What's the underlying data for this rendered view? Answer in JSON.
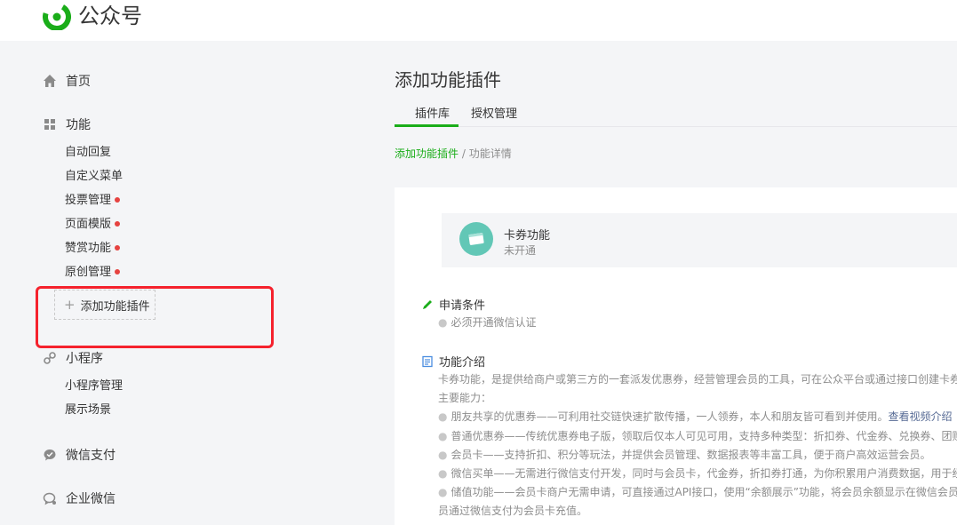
{
  "header": {
    "app_name": "公众号"
  },
  "sidebar": {
    "home": "首页",
    "features": {
      "label": "功能",
      "items": [
        {
          "label": "自动回复",
          "dot": false
        },
        {
          "label": "自定义菜单",
          "dot": false
        },
        {
          "label": "投票管理",
          "dot": true
        },
        {
          "label": "页面模版",
          "dot": true
        },
        {
          "label": "赞赏功能",
          "dot": true
        },
        {
          "label": "原创管理",
          "dot": true
        }
      ],
      "add_plugin": "添加功能插件"
    },
    "miniprogram": {
      "label": "小程序",
      "items": [
        {
          "label": "小程序管理"
        },
        {
          "label": "展示场景"
        }
      ]
    },
    "wechat_pay": "微信支付",
    "work_wechat": "企业微信"
  },
  "main": {
    "title": "添加功能插件",
    "tabs": [
      {
        "label": "插件库",
        "active": true
      },
      {
        "label": "授权管理",
        "active": false
      }
    ],
    "breadcrumb": {
      "link": "添加功能插件",
      "separator": " / ",
      "current": "功能详情"
    },
    "card": {
      "title": "卡券功能",
      "status": "未开通"
    },
    "conditions": {
      "heading": "申请条件",
      "items": [
        "必须开通微信认证"
      ]
    },
    "intro": {
      "heading": "功能介绍",
      "line1": "卡券功能，是提供给商户或第三方的一套派发优惠券，经营管理会员的工具，可在公众平台或通过接口创建卡券",
      "line2": "主要能力：",
      "bullets": [
        {
          "text": "朋友共享的优惠券——可利用社交链快速扩散传播，一人领券，本人和朋友皆可看到并使用。",
          "link": "查看视频介绍"
        },
        {
          "text": "普通优惠券——传统优惠券电子版，领取后仅本人可见可用，支持多种类型：折扣券、代金券、兑换券、团购"
        },
        {
          "text": "会员卡——支持折扣、积分等玩法，并提供会员管理、数据报表等丰富工具，便于商户高效运营会员。"
        },
        {
          "text": "微信买单——无需进行微信支付开发，同时与会员卡，代金券，折扣券打通，为你积累用户消费数据，用于经营"
        },
        {
          "text": "储值功能——会员卡商户无需申请，可直接通过API接口，使用“余额展示”功能，将会员余额显示在微信会员卡"
        }
      ],
      "tail": "员通过微信支付为会员卡充值。"
    }
  },
  "colors": {
    "brand": "#1aad19",
    "highlight": "#f5222d",
    "dot": "#e64340"
  }
}
